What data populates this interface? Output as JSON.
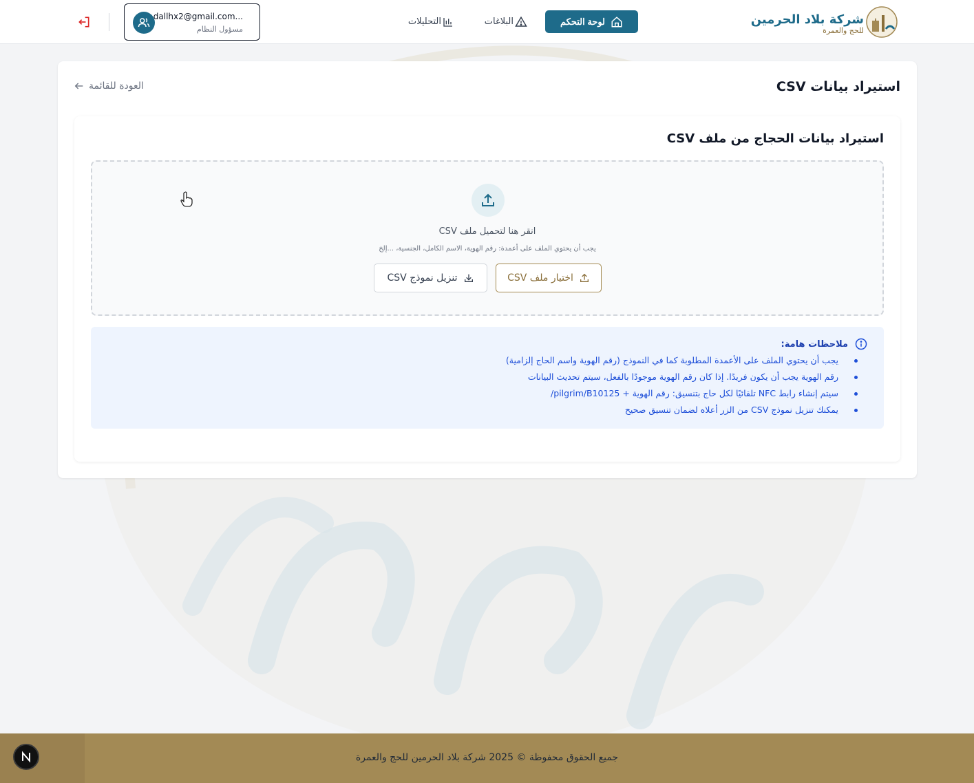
{
  "header": {
    "brand_name": "شركة بلاد الحرمين",
    "brand_subtitle": "للحج والعمرة",
    "nav": {
      "dashboard": "لوحة التحكم",
      "reports": "البلاغات",
      "analytics": "التحليلات"
    },
    "user": {
      "email": "dallhx2@gmail.com...",
      "role": "مسؤول النظام"
    }
  },
  "page": {
    "title": "استيراد بيانات CSV",
    "back_label": "العودة للقائمة"
  },
  "import": {
    "title": "استيراد بيانات الحجاج من ملف CSV",
    "drop_main": "انقر هنا لتحميل ملف CSV",
    "drop_hint": "يجب أن يحتوي الملف على أعمدة: رقم الهوية، الاسم الكامل، الجنسية، ...إلخ",
    "choose_button": "اختيار ملف CSV",
    "template_button": "تنزيل نموذج CSV"
  },
  "notes": {
    "heading": "ملاحظات هامة:",
    "items": [
      "يجب أن يحتوي الملف على الأعمدة المطلوبة كما في النموذج (رقم الهوية واسم الحاج إلزامية)",
      "رقم الهوية يجب أن يكون فريدًا. إذا كان رقم الهوية موجودًا بالفعل، سيتم تحديث البيانات",
      "سيتم إنشاء رابط NFC تلقائيًا لكل حاج بتنسيق: رقم الهوية + pilgrim/B10125/",
      "يمكنك تنزيل نموذج CSV من الزر أعلاه لضمان تنسيق صحيح"
    ]
  },
  "footer": {
    "text": "جميع الحقوق محفوظة © 2025 شركة بلاد الحرمين للحج والعمرة"
  },
  "colors": {
    "primary": "#1e6b8a",
    "gold": "#a38a55",
    "notes_bg": "#eef4fe",
    "notes_text": "#1d4ed8",
    "logout": "#dc2626"
  },
  "icons": {
    "dashboard": "home-icon",
    "reports": "warning-triangle-icon",
    "analytics": "bar-chart-icon",
    "user": "users-icon",
    "logout": "logout-icon",
    "back": "arrow-left-icon",
    "upload": "upload-icon",
    "download": "download-icon",
    "info": "info-icon"
  }
}
